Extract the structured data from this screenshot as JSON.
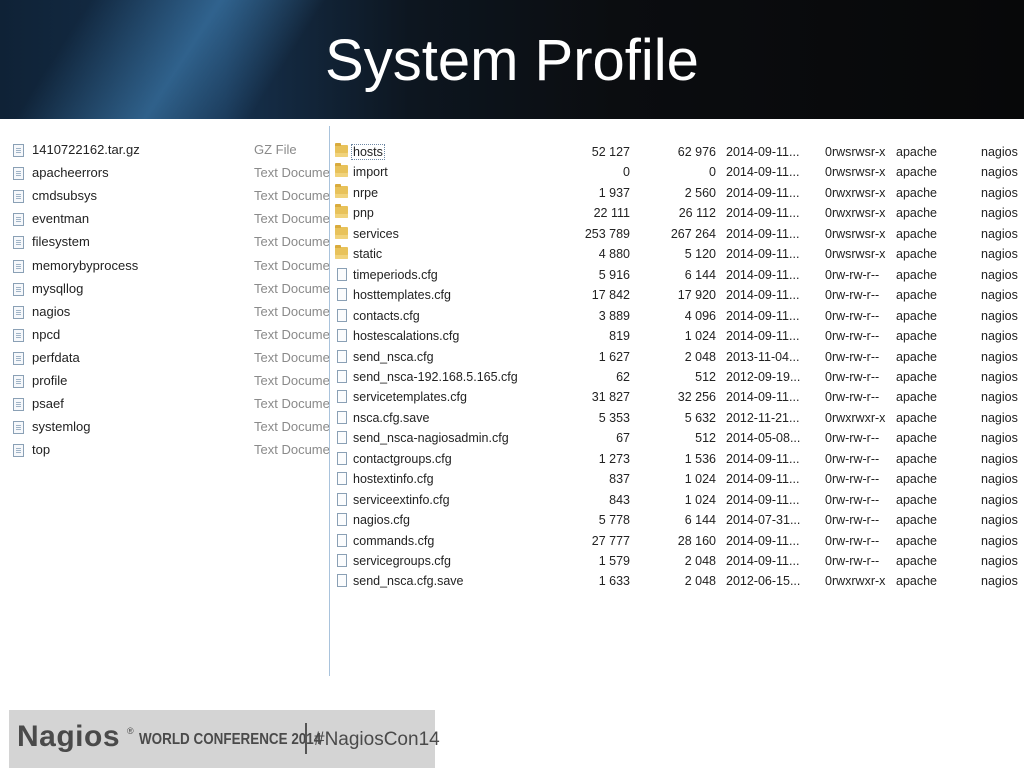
{
  "slide": {
    "title": "System Profile"
  },
  "left_pane": {
    "items": [
      {
        "name": "1410722162.tar.gz",
        "type": "GZ File"
      },
      {
        "name": "apacheerrors",
        "type": "Text Document"
      },
      {
        "name": "cmdsubsys",
        "type": "Text Document"
      },
      {
        "name": "eventman",
        "type": "Text Document"
      },
      {
        "name": "filesystem",
        "type": "Text Document"
      },
      {
        "name": "memorybyprocess",
        "type": "Text Document"
      },
      {
        "name": "mysqllog",
        "type": "Text Document"
      },
      {
        "name": "nagios",
        "type": "Text Document"
      },
      {
        "name": "npcd",
        "type": "Text Document"
      },
      {
        "name": "perfdata",
        "type": "Text Document"
      },
      {
        "name": "profile",
        "type": "Text Document"
      },
      {
        "name": "psaef",
        "type": "Text Document"
      },
      {
        "name": "systemlog",
        "type": "Text Document"
      },
      {
        "name": "top",
        "type": "Text Document"
      }
    ]
  },
  "right_pane": {
    "rows": [
      {
        "icon": "folder-icon",
        "name": "hosts",
        "size": "52 127",
        "packed": "62 976",
        "modified": "2014-09-11...",
        "attributes": "0rwsrwsr-x",
        "owner": "apache",
        "group": "nagios",
        "selected": true
      },
      {
        "icon": "folder-icon",
        "name": "import",
        "size": "0",
        "packed": "0",
        "modified": "2014-09-11...",
        "attributes": "0rwsrwsr-x",
        "owner": "apache",
        "group": "nagios"
      },
      {
        "icon": "folder-icon",
        "name": "nrpe",
        "size": "1 937",
        "packed": "2 560",
        "modified": "2014-09-11...",
        "attributes": "0rwxrwsr-x",
        "owner": "apache",
        "group": "nagios"
      },
      {
        "icon": "folder-icon",
        "name": "pnp",
        "size": "22 111",
        "packed": "26 112",
        "modified": "2014-09-11...",
        "attributes": "0rwxrwsr-x",
        "owner": "apache",
        "group": "nagios"
      },
      {
        "icon": "folder-icon",
        "name": "services",
        "size": "253 789",
        "packed": "267 264",
        "modified": "2014-09-11...",
        "attributes": "0rwsrwsr-x",
        "owner": "apache",
        "group": "nagios"
      },
      {
        "icon": "folder-icon",
        "name": "static",
        "size": "4 880",
        "packed": "5 120",
        "modified": "2014-09-11...",
        "attributes": "0rwsrwsr-x",
        "owner": "apache",
        "group": "nagios"
      },
      {
        "icon": "file-icon",
        "name": "timeperiods.cfg",
        "size": "5 916",
        "packed": "6 144",
        "modified": "2014-09-11...",
        "attributes": "0rw-rw-r--",
        "owner": "apache",
        "group": "nagios"
      },
      {
        "icon": "file-icon",
        "name": "hosttemplates.cfg",
        "size": "17 842",
        "packed": "17 920",
        "modified": "2014-09-11...",
        "attributes": "0rw-rw-r--",
        "owner": "apache",
        "group": "nagios"
      },
      {
        "icon": "file-icon",
        "name": "contacts.cfg",
        "size": "3 889",
        "packed": "4 096",
        "modified": "2014-09-11...",
        "attributes": "0rw-rw-r--",
        "owner": "apache",
        "group": "nagios"
      },
      {
        "icon": "file-icon",
        "name": "hostescalations.cfg",
        "size": "819",
        "packed": "1 024",
        "modified": "2014-09-11...",
        "attributes": "0rw-rw-r--",
        "owner": "apache",
        "group": "nagios"
      },
      {
        "icon": "file-icon",
        "name": "send_nsca.cfg",
        "size": "1 627",
        "packed": "2 048",
        "modified": "2013-11-04...",
        "attributes": "0rw-rw-r--",
        "owner": "apache",
        "group": "nagios"
      },
      {
        "icon": "file-icon",
        "name": "send_nsca-192.168.5.165.cfg",
        "size": "62",
        "packed": "512",
        "modified": "2012-09-19...",
        "attributes": "0rw-rw-r--",
        "owner": "apache",
        "group": "nagios"
      },
      {
        "icon": "file-icon",
        "name": "servicetemplates.cfg",
        "size": "31 827",
        "packed": "32 256",
        "modified": "2014-09-11...",
        "attributes": "0rw-rw-r--",
        "owner": "apache",
        "group": "nagios"
      },
      {
        "icon": "file-icon",
        "name": "nsca.cfg.save",
        "size": "5 353",
        "packed": "5 632",
        "modified": "2012-11-21...",
        "attributes": "0rwxrwxr-x",
        "owner": "apache",
        "group": "nagios"
      },
      {
        "icon": "file-icon",
        "name": "send_nsca-nagiosadmin.cfg",
        "size": "67",
        "packed": "512",
        "modified": "2014-05-08...",
        "attributes": "0rw-rw-r--",
        "owner": "apache",
        "group": "nagios"
      },
      {
        "icon": "file-icon",
        "name": "contactgroups.cfg",
        "size": "1 273",
        "packed": "1 536",
        "modified": "2014-09-11...",
        "attributes": "0rw-rw-r--",
        "owner": "apache",
        "group": "nagios"
      },
      {
        "icon": "file-icon",
        "name": "hostextinfo.cfg",
        "size": "837",
        "packed": "1 024",
        "modified": "2014-09-11...",
        "attributes": "0rw-rw-r--",
        "owner": "apache",
        "group": "nagios"
      },
      {
        "icon": "file-icon",
        "name": "serviceextinfo.cfg",
        "size": "843",
        "packed": "1 024",
        "modified": "2014-09-11...",
        "attributes": "0rw-rw-r--",
        "owner": "apache",
        "group": "nagios"
      },
      {
        "icon": "file-icon",
        "name": "nagios.cfg",
        "size": "5 778",
        "packed": "6 144",
        "modified": "2014-07-31...",
        "attributes": "0rw-rw-r--",
        "owner": "apache",
        "group": "nagios"
      },
      {
        "icon": "file-icon",
        "name": "commands.cfg",
        "size": "27 777",
        "packed": "28 160",
        "modified": "2014-09-11...",
        "attributes": "0rw-rw-r--",
        "owner": "apache",
        "group": "nagios"
      },
      {
        "icon": "file-icon",
        "name": "servicegroups.cfg",
        "size": "1 579",
        "packed": "2 048",
        "modified": "2014-09-11...",
        "attributes": "0rw-rw-r--",
        "owner": "apache",
        "group": "nagios"
      },
      {
        "icon": "file-icon",
        "name": "send_nsca.cfg.save",
        "size": "1 633",
        "packed": "2 048",
        "modified": "2012-06-15...",
        "attributes": "0rwxrwxr-x",
        "owner": "apache",
        "group": "nagios"
      }
    ]
  },
  "footer": {
    "brand": "Nagios",
    "registered": "®",
    "conference": "WORLD CONFERENCE 2014",
    "hashtag": "#NagiosCon14"
  }
}
